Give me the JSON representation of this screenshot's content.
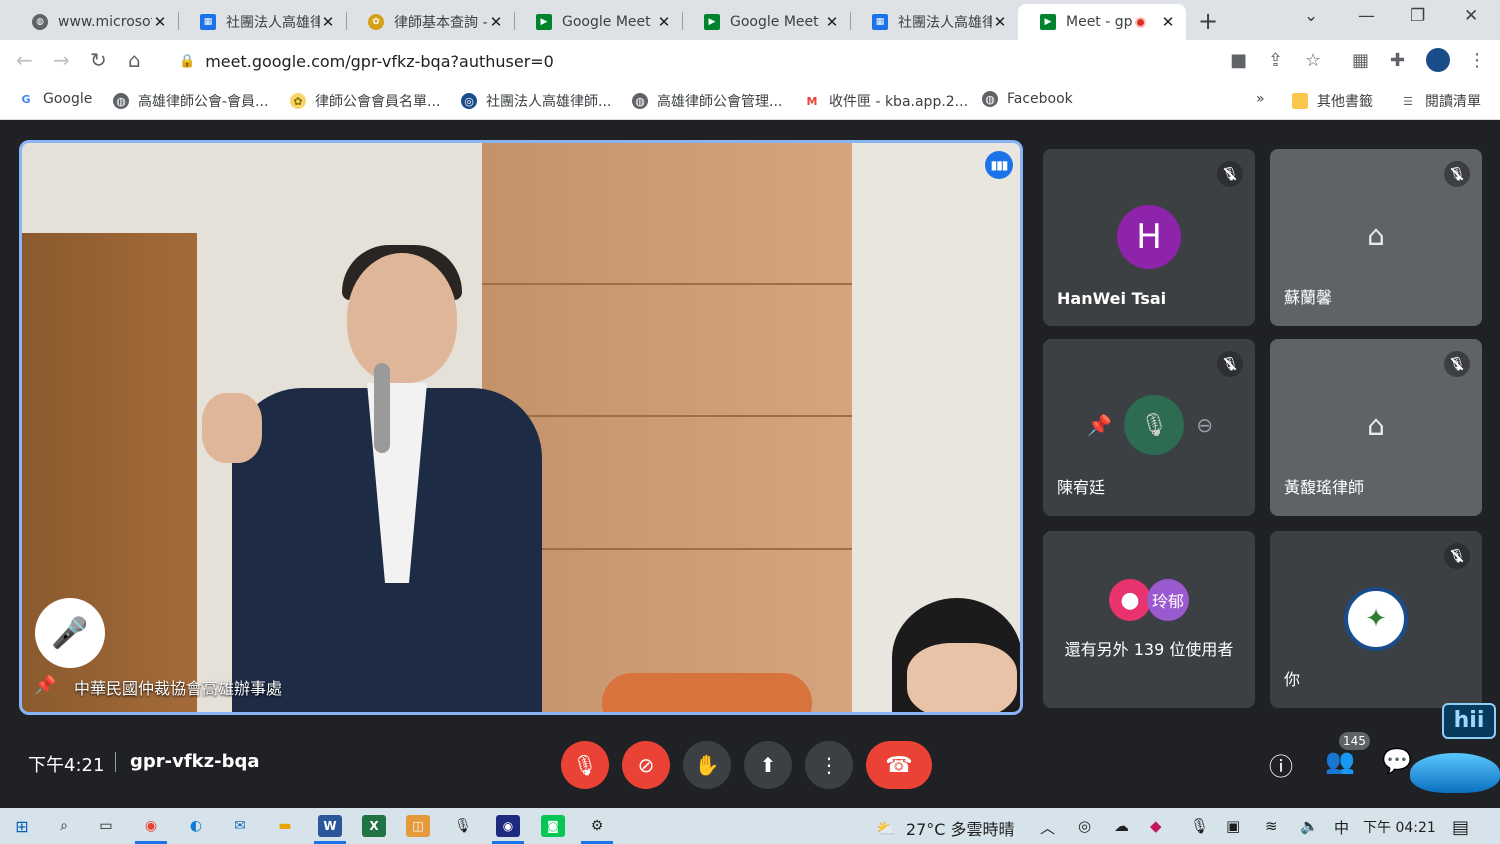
{
  "browser": {
    "tabs": [
      {
        "title": "www.microsof",
        "icon": "globe-icon",
        "color": "#5f6368"
      },
      {
        "title": "社團法人高雄律",
        "icon": "calendar-icon",
        "color": "#1a73e8"
      },
      {
        "title": "律師基本查詢 -",
        "icon": "emblem-icon",
        "color": "#d4a017"
      },
      {
        "title": "Google Meet",
        "icon": "meet-icon",
        "color": "#00832d"
      },
      {
        "title": "Google Meet",
        "icon": "meet-icon",
        "color": "#00832d"
      },
      {
        "title": "社團法人高雄律",
        "icon": "calendar-icon",
        "color": "#1a73e8"
      },
      {
        "title": "Meet - gp",
        "icon": "meet-icon",
        "color": "#00832d",
        "active": true
      }
    ],
    "url": "meet.google.com/gpr-vfkz-bqa?authuser=0",
    "bookmarks": [
      {
        "label": "Google",
        "icon": "google-icon"
      },
      {
        "label": "高雄律師公會-會員...",
        "icon": "globe-icon"
      },
      {
        "label": "律師公會會員名單...",
        "icon": "emblem-icon"
      },
      {
        "label": "社團法人高雄律師...",
        "icon": "seal-icon"
      },
      {
        "label": "高雄律師公會管理...",
        "icon": "globe-icon"
      },
      {
        "label": "收件匣 - kba.app.2...",
        "icon": "gmail-icon"
      },
      {
        "label": "Facebook",
        "icon": "globe-icon"
      }
    ],
    "bookmarks_more": "»",
    "other_bookmarks": "其他書籤",
    "reading_list": "閱讀清單"
  },
  "meet": {
    "main_speaker": {
      "name": "中華民國仲裁協會高雄辦事處"
    },
    "tiles": [
      {
        "name": "HanWei Tsai",
        "initial": "H",
        "avatar_color": "#8e24aa",
        "muted": true
      },
      {
        "name": "蘇蘭馨",
        "muted": true
      },
      {
        "name": "陳宥廷",
        "muted": true
      },
      {
        "name": "黃馥瑤律師",
        "muted": true
      },
      {
        "name": "你",
        "muted": true
      }
    ],
    "others": {
      "text": "還有另外 139 位使用者",
      "avatar_label": "玲郁"
    },
    "clock": "下午4:21",
    "meeting_code": "gpr-vfkz-bqa",
    "participant_count": "145",
    "overlay_label": "hii"
  },
  "taskbar": {
    "weather": "27°C 多雲時晴",
    "ime": "中",
    "time": "下午 04:21"
  }
}
